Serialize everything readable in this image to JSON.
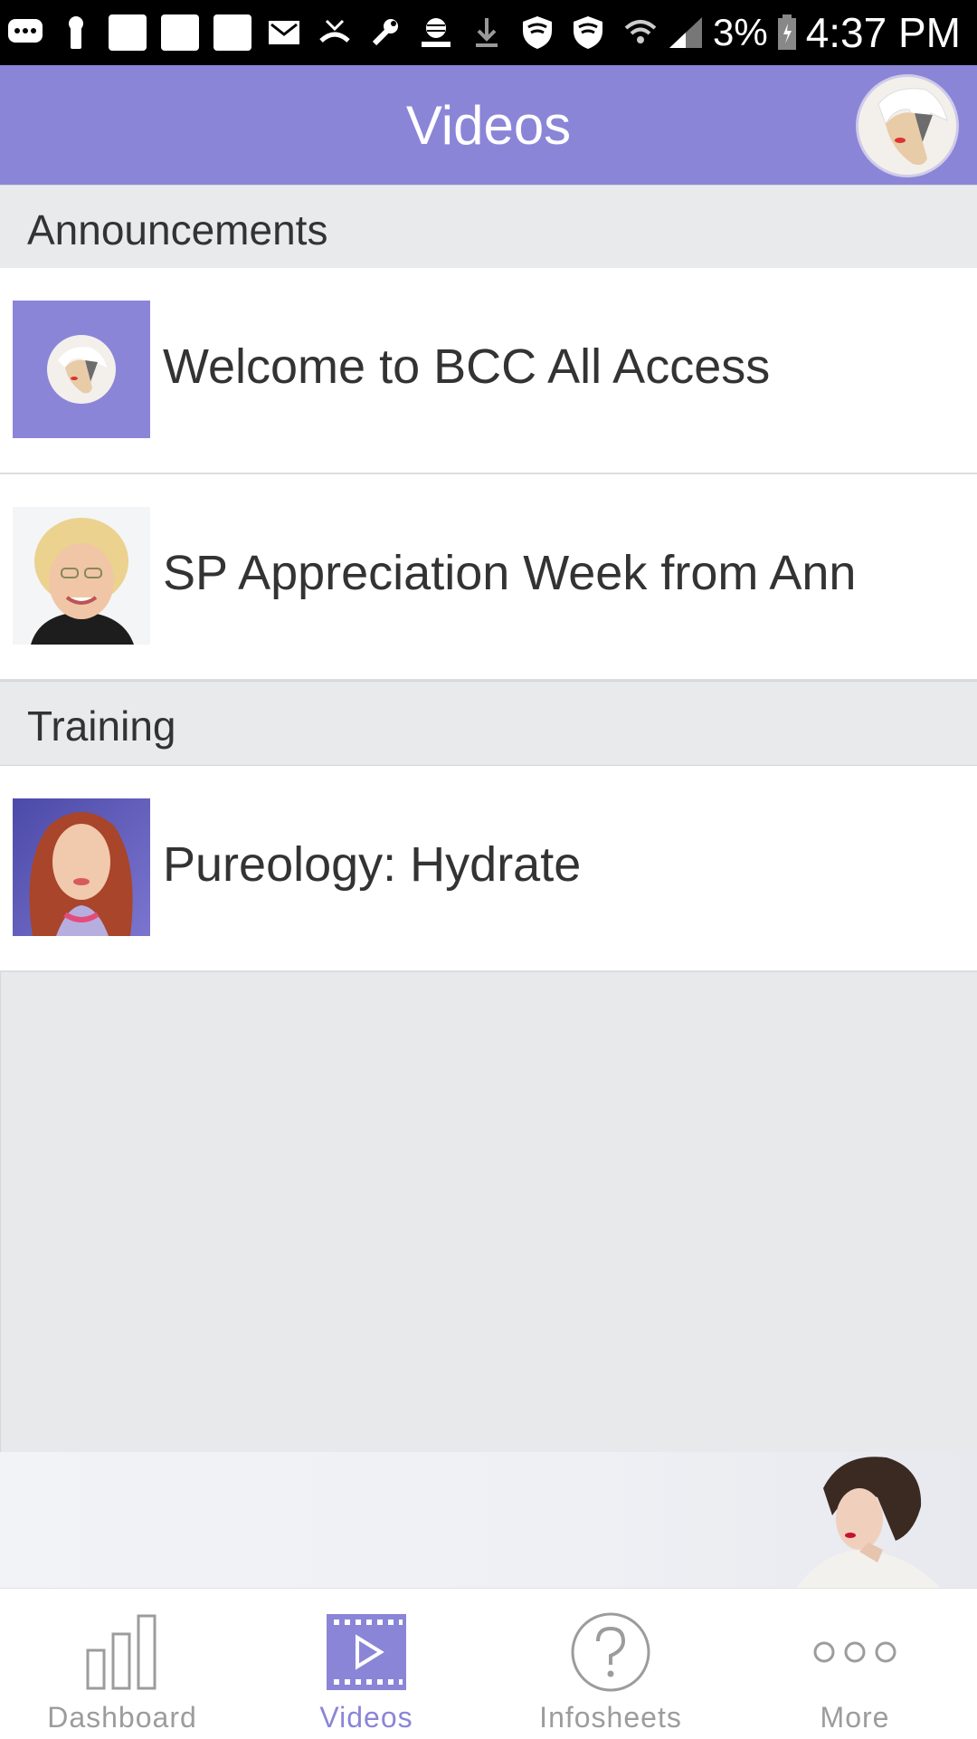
{
  "status_bar": {
    "battery_text": "3%",
    "time": "4:37 PM"
  },
  "app_bar": {
    "title": "Videos"
  },
  "sections": [
    {
      "header": "Announcements",
      "items": [
        {
          "title": "Welcome to BCC All Access",
          "thumb": "brand-logo-thumbnail"
        },
        {
          "title": "SP Appreciation Week from Ann",
          "thumb": "presenter-photo-thumbnail"
        }
      ]
    },
    {
      "header": "Training",
      "items": [
        {
          "title": "Pureology: Hydrate",
          "thumb": "model-photo-thumbnail"
        }
      ]
    }
  ],
  "tabs": [
    {
      "label": "Dashboard",
      "icon": "bar-chart-icon",
      "active": false
    },
    {
      "label": "Videos",
      "icon": "film-play-icon",
      "active": true
    },
    {
      "label": "Infosheets",
      "icon": "question-circle-icon",
      "active": false
    },
    {
      "label": "More",
      "icon": "more-dots-icon",
      "active": false
    }
  ],
  "colors": {
    "accent": "#8b85d8",
    "section_bg": "#e9eaec",
    "inactive_tab": "#9c9c9c"
  }
}
